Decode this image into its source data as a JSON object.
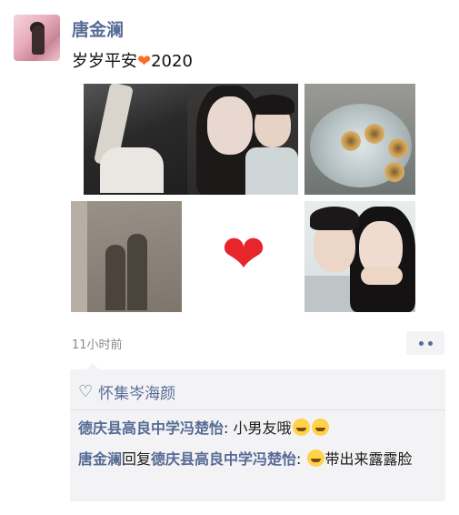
{
  "post": {
    "author": "唐金澜",
    "text_prefix": "岁岁平安",
    "text_heart": "❤",
    "text_suffix": "2020",
    "time": "11小时前"
  },
  "photos": [
    {
      "icon": "photo-holding-hands"
    },
    {
      "icon": "photo-couple-selfie"
    },
    {
      "icon": "photo-bouquet"
    },
    {
      "icon": "photo-shadows"
    },
    {
      "icon": "heart-emoji"
    },
    {
      "icon": "photo-couple-selfie-2"
    }
  ],
  "likes": {
    "icon": "heart-outline-icon",
    "names": "怀集岑海颜"
  },
  "comments": [
    {
      "user": "德庆县高良中学冯楚怡",
      "sep": ": ",
      "text": "小男友哦"
    },
    {
      "user": "唐金澜",
      "reply_word": "回复",
      "reply_to": "德庆县高良中学冯楚怡",
      "sep": ": ",
      "text": "带出来露露脸"
    }
  ],
  "colors": {
    "link": "#576b95",
    "comment_bg": "#f3f3f5",
    "heart": "#e6262b"
  }
}
